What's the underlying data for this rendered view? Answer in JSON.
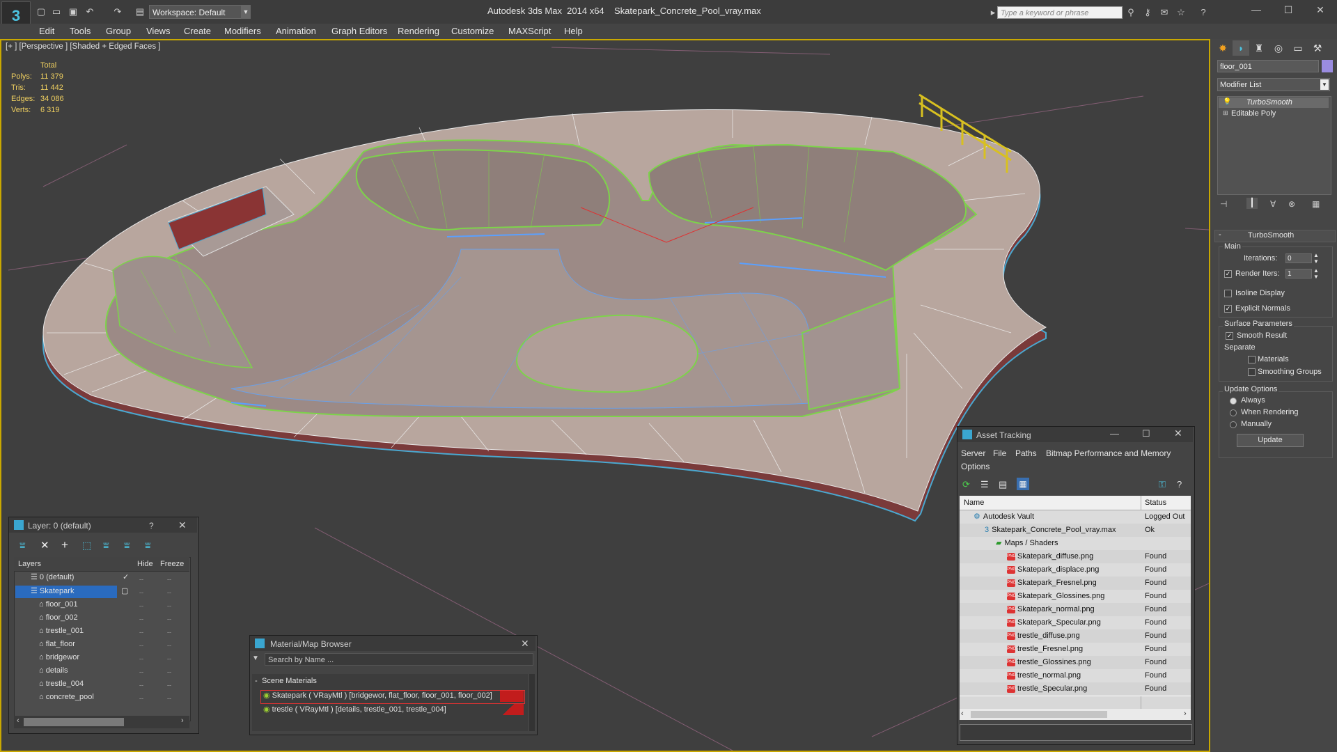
{
  "titlebar": {
    "app_title": "Autodesk 3ds Max  2014 x64",
    "file_title": "Skatepark_Concrete_Pool_vray.max",
    "workspace": "Workspace: Default",
    "search_placeholder": "Type a keyword or phrase",
    "logo": "3",
    "quick_access_icons": [
      "new-file-icon",
      "open-file-icon",
      "save-icon",
      "undo-icon",
      "redo-icon",
      "project-folder-icon"
    ]
  },
  "menu": [
    "Edit",
    "Tools",
    "Group",
    "Views",
    "Create",
    "Modifiers",
    "Animation",
    "Graph Editors",
    "Rendering",
    "Customize",
    "MAXScript",
    "Help"
  ],
  "viewport": {
    "label": "[+ ] [Perspective ] [Shaded + Edged Faces ]",
    "stats_header": "Total",
    "stats": [
      {
        "label": "Polys:",
        "value": "11 379"
      },
      {
        "label": "Tris:",
        "value": "11 442"
      },
      {
        "label": "Edges:",
        "value": "34 086"
      },
      {
        "label": "Verts:",
        "value": "6 319"
      }
    ]
  },
  "command_panel": {
    "object_name": "floor_001",
    "object_color": "#9a8ce0",
    "modifier_list": "Modifier List",
    "stack": [
      "TurboSmooth",
      "Editable Poly"
    ],
    "rollout_title": "TurboSmooth",
    "main_group": "Main",
    "iterations_label": "Iterations:",
    "iterations_value": "0",
    "render_iters_label": "Render Iters:",
    "render_iters_value": "1",
    "isoline_display": "Isoline Display",
    "explicit_normals": "Explicit Normals",
    "surface_params": "Surface Parameters",
    "smooth_result": "Smooth Result",
    "separate": "Separate",
    "materials": "Materials",
    "smoothing_groups": "Smoothing Groups",
    "update_options": "Update Options",
    "always": "Always",
    "when_rendering": "When Rendering",
    "manually": "Manually",
    "update_button": "Update"
  },
  "layer_window": {
    "title": "Layer: 0 (default)",
    "help": "?",
    "col_layers": "Layers",
    "col_hide": "Hide",
    "col_freeze": "Freeze",
    "rows": [
      {
        "name": "0 (default)",
        "indent": 0
      },
      {
        "name": "Skatepark",
        "indent": 0
      },
      {
        "name": "floor_001",
        "indent": 1
      },
      {
        "name": "floor_002",
        "indent": 1
      },
      {
        "name": "trestle_001",
        "indent": 1
      },
      {
        "name": "flat_floor",
        "indent": 1
      },
      {
        "name": "bridgewor",
        "indent": 1
      },
      {
        "name": "details",
        "indent": 1
      },
      {
        "name": "trestle_004",
        "indent": 1
      },
      {
        "name": "concrete_pool",
        "indent": 1
      }
    ]
  },
  "material_browser": {
    "title": "Material/Map Browser",
    "search_placeholder": "Search by Name ...",
    "group": "Scene Materials",
    "items": [
      "Skatepark  ( VRayMtl ) [bridgewor, flat_floor, floor_001, floor_002]",
      "trestle  ( VRayMtl ) [details, trestle_001, trestle_004]"
    ]
  },
  "asset_tracking": {
    "title": "Asset Tracking",
    "menu": [
      "Server",
      "File",
      "Paths",
      "Bitmap Performance and Memory"
    ],
    "menu2": "Options",
    "col_name": "Name",
    "col_status": "Status",
    "rows": [
      {
        "name": "Autodesk Vault",
        "status": "Logged Out",
        "level": 0,
        "type": "vault"
      },
      {
        "name": "Skatepark_Concrete_Pool_vray.max",
        "status": "Ok",
        "level": 1,
        "type": "max"
      },
      {
        "name": "Maps / Shaders",
        "status": "",
        "level": 2,
        "type": "folder"
      },
      {
        "name": "Skatepark_diffuse.png",
        "status": "Found",
        "level": 3,
        "type": "png"
      },
      {
        "name": "Skatepark_displace.png",
        "status": "Found",
        "level": 3,
        "type": "png"
      },
      {
        "name": "Skatepark_Fresnel.png",
        "status": "Found",
        "level": 3,
        "type": "png"
      },
      {
        "name": "Skatepark_Glossines.png",
        "status": "Found",
        "level": 3,
        "type": "png"
      },
      {
        "name": "Skatepark_normal.png",
        "status": "Found",
        "level": 3,
        "type": "png"
      },
      {
        "name": "Skatepark_Specular.png",
        "status": "Found",
        "level": 3,
        "type": "png"
      },
      {
        "name": "trestle_diffuse.png",
        "status": "Found",
        "level": 3,
        "type": "png"
      },
      {
        "name": "trestle_Fresnel.png",
        "status": "Found",
        "level": 3,
        "type": "png"
      },
      {
        "name": "trestle_Glossines.png",
        "status": "Found",
        "level": 3,
        "type": "png"
      },
      {
        "name": "trestle_normal.png",
        "status": "Found",
        "level": 3,
        "type": "png"
      },
      {
        "name": "trestle_Specular.png",
        "status": "Found",
        "level": 3,
        "type": "png"
      }
    ]
  }
}
